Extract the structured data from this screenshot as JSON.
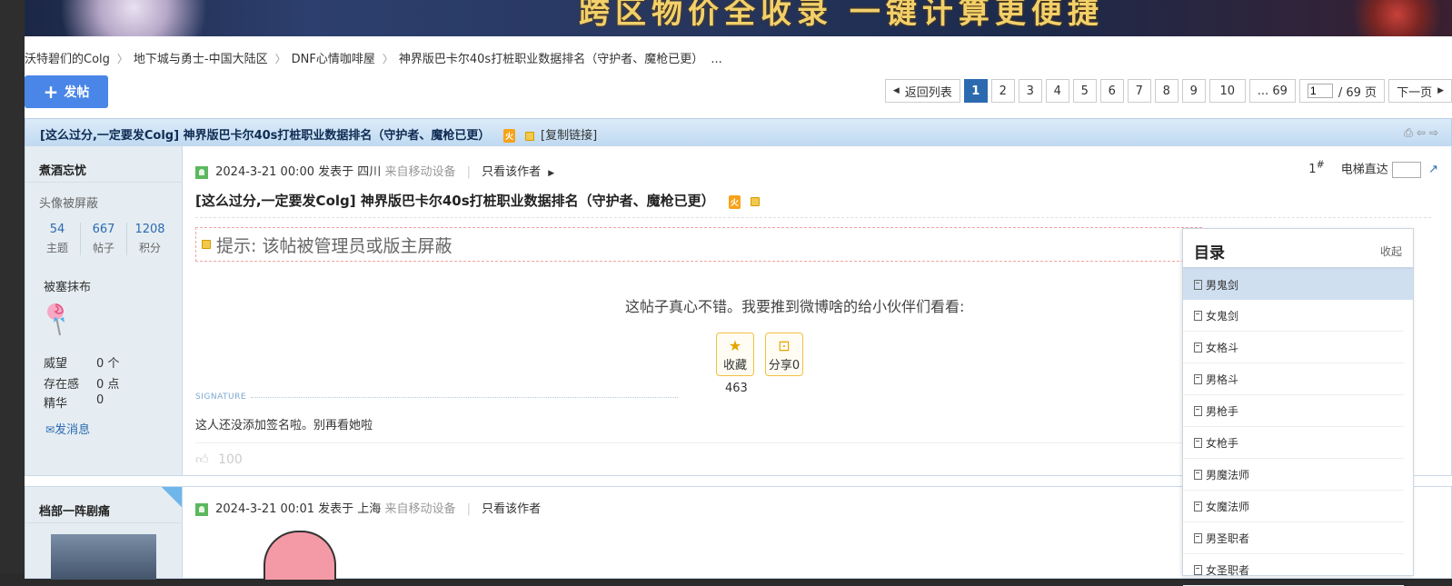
{
  "banner": {
    "title": "跨区物价全收录 一键计算更便捷"
  },
  "breadcrumb": {
    "items": [
      "沃特碧们的Colg",
      "地下城与勇士-中国大陆区",
      "DNF心情咖啡屋",
      "神界版巴卡尔40s打桩职业数据排名（守护者、魔枪已更）",
      "..."
    ],
    "sep": "〉"
  },
  "toolbar": {
    "post_label": "发帖"
  },
  "pager": {
    "back_label": "返回列表",
    "pages": [
      "1",
      "2",
      "3",
      "4",
      "5",
      "6",
      "7",
      "8",
      "9",
      "10"
    ],
    "current": "1",
    "last_label": "... 69",
    "input_value": "1",
    "total_label": "/ 69 页",
    "next_label": "下一页"
  },
  "thread": {
    "title": "[这么过分,一定要发Colg] 神界版巴卡尔40s打桩职业数据排名（守护者、魔枪已更）",
    "hot_badge": "火",
    "copy_link": "[复制链接]"
  },
  "post1": {
    "author": "煮酒忘忧",
    "avatar_text": "头像被屏蔽",
    "stats": [
      {
        "value": "54",
        "label": "主题"
      },
      {
        "value": "667",
        "label": "帖子"
      },
      {
        "value": "1208",
        "label": "积分"
      }
    ],
    "medal_title": "被塞抹布",
    "fields": [
      {
        "label": "威望",
        "value": "0 个"
      },
      {
        "label": "存在感",
        "value": "0 点"
      },
      {
        "label": "精华",
        "value": "0"
      }
    ],
    "send_msg": "发消息",
    "date": "2024-3-21 00:00",
    "posted_in": "发表于 四川",
    "device": "来自移动设备",
    "only_author": "只看该作者",
    "floor": "1",
    "floor_suffix": "#",
    "elevator": "电梯直达",
    "title": "[这么过分,一定要发Colg] 神界版巴卡尔40s打桩职业数据排名（守护者、魔枪已更）",
    "hidden_tip": "提示: 该帖被管理员或版主屏蔽",
    "share_text": "这帖子真心不错。我要推到微博啥的给小伙伴们看看:",
    "fav_label": "收藏",
    "share_label": "分享0",
    "fav_count": "463",
    "signature_label": "SIGNATURE",
    "signature_text": "这人还没添加签名啦。别再看她啦",
    "like_count": "100"
  },
  "post2": {
    "author": "档部一阵剧痛",
    "date": "2024-3-21 00:01",
    "posted_in": "发表于 上海",
    "device": "来自移动设备",
    "only_author": "只看该作者"
  },
  "toc": {
    "title": "目录",
    "collapse": "收起",
    "items": [
      "男鬼剑",
      "女鬼剑",
      "女格斗",
      "男格斗",
      "男枪手",
      "女枪手",
      "男魔法师",
      "女魔法师",
      "男圣职者",
      "女圣职者"
    ]
  },
  "colors": {
    "accent": "#4a86e8",
    "link": "#2c6ab0",
    "header_bg": "#cfe2f5",
    "sidebar_bg": "#e5edf2"
  }
}
